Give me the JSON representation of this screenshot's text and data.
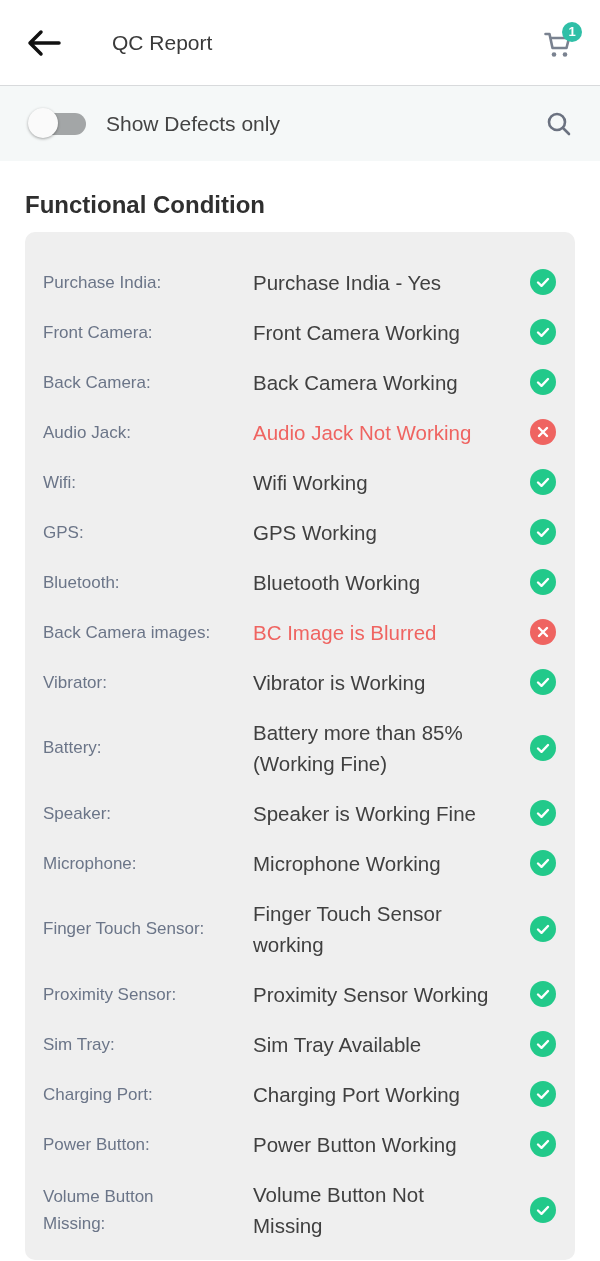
{
  "header": {
    "title": "QC Report",
    "cart_badge": "1"
  },
  "filter": {
    "label": "Show Defects only",
    "on": false
  },
  "section": {
    "title": "Functional Condition",
    "rows": [
      {
        "label": "Purchase India:",
        "value": "Purchase India - Yes",
        "defect": false
      },
      {
        "label": "Front Camera:",
        "value": "Front Camera Working",
        "defect": false
      },
      {
        "label": "Back Camera:",
        "value": "Back Camera Working",
        "defect": false
      },
      {
        "label": "Audio Jack:",
        "value": "Audio Jack Not Working",
        "defect": true
      },
      {
        "label": "Wifi:",
        "value": "Wifi Working",
        "defect": false
      },
      {
        "label": "GPS:",
        "value": "GPS Working",
        "defect": false
      },
      {
        "label": "Bluetooth:",
        "value": "Bluetooth Working",
        "defect": false
      },
      {
        "label": "Back Camera images:",
        "value": "BC Image is Blurred",
        "defect": true
      },
      {
        "label": "Vibrator:",
        "value": "Vibrator is Working",
        "defect": false
      },
      {
        "label": "Battery:",
        "value": "Battery more than 85% (Working Fine)",
        "defect": false
      },
      {
        "label": "Speaker:",
        "value": "Speaker is Working Fine",
        "defect": false
      },
      {
        "label": "Microphone:",
        "value": "Microphone Working",
        "defect": false
      },
      {
        "label": "Finger Touch Sensor:",
        "value": "Finger Touch Sensor working",
        "defect": false
      },
      {
        "label": "Proximity Sensor:",
        "value": "Proximity Sensor Working",
        "defect": false
      },
      {
        "label": "Sim Tray:",
        "value": "Sim Tray Available",
        "defect": false
      },
      {
        "label": "Charging Port:",
        "value": "Charging Port Working",
        "defect": false
      },
      {
        "label": "Power Button:",
        "value": "Power Button Working",
        "defect": false
      },
      {
        "label": "Volume Button Missing:",
        "value": "Volume Button Not Missing",
        "defect": false
      }
    ]
  }
}
